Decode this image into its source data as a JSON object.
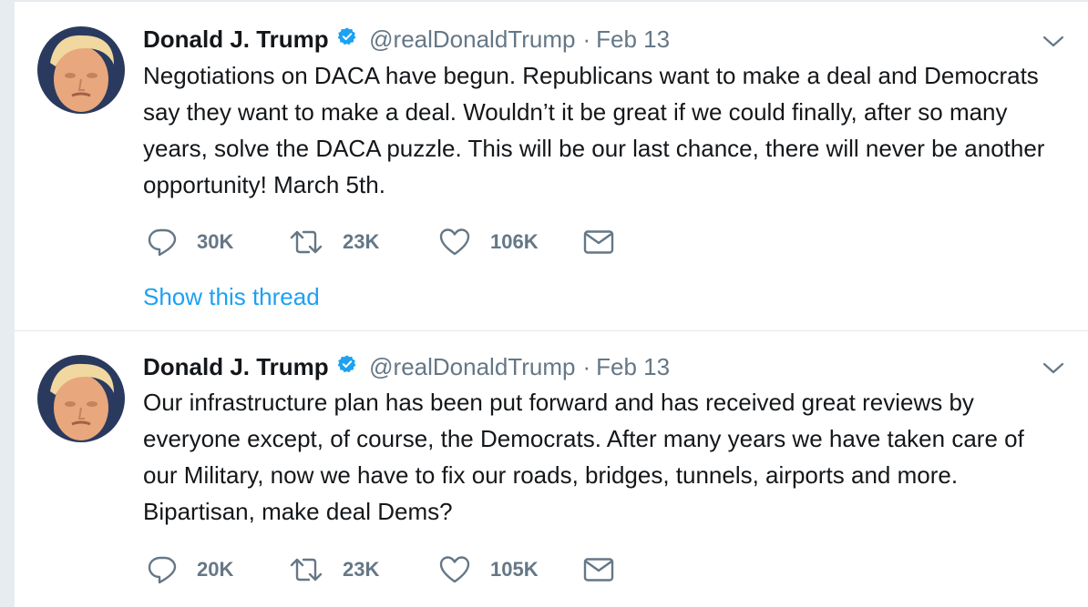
{
  "tweets": [
    {
      "author": {
        "name": "Donald J. Trump",
        "handle": "@realDonaldTrump",
        "verified": true,
        "avatar_icon": "profile-photo-avatar"
      },
      "separator": "·",
      "date": "Feb 13",
      "text": "Negotiations on DACA have begun. Republicans want to make a deal and Democrats say they want to make a deal. Wouldn’t it be great if we could finally, after so many years, solve the DACA puzzle. This will be our last chance, there will never be another opportunity! March 5th.",
      "actions": {
        "replies": "30K",
        "retweets": "23K",
        "likes": "106K"
      },
      "show_thread_label": "Show this thread"
    },
    {
      "author": {
        "name": "Donald J. Trump",
        "handle": "@realDonaldTrump",
        "verified": true,
        "avatar_icon": "profile-photo-avatar"
      },
      "separator": "·",
      "date": "Feb 13",
      "text": "Our infrastructure plan has been put forward and has received great reviews by everyone except, of course, the Democrats. After many years we have taken care of our Military, now we have to fix our roads, bridges, tunnels, airports and more. Bipartisan, make deal Dems?",
      "actions": {
        "replies": "20K",
        "retweets": "23K",
        "likes": "105K"
      }
    }
  ],
  "icons": {
    "reply": "speech-bubble-icon",
    "retweet": "retweet-arrows-icon",
    "like": "heart-icon",
    "direct_message": "envelope-icon",
    "verified": "verified-badge-icon",
    "more": "chevron-down-icon"
  },
  "colors": {
    "text": "#14171a",
    "secondary": "#657786",
    "link": "#1da1f2",
    "verified": "#1da1f2",
    "background": "#e6ecf0",
    "card": "#ffffff"
  }
}
